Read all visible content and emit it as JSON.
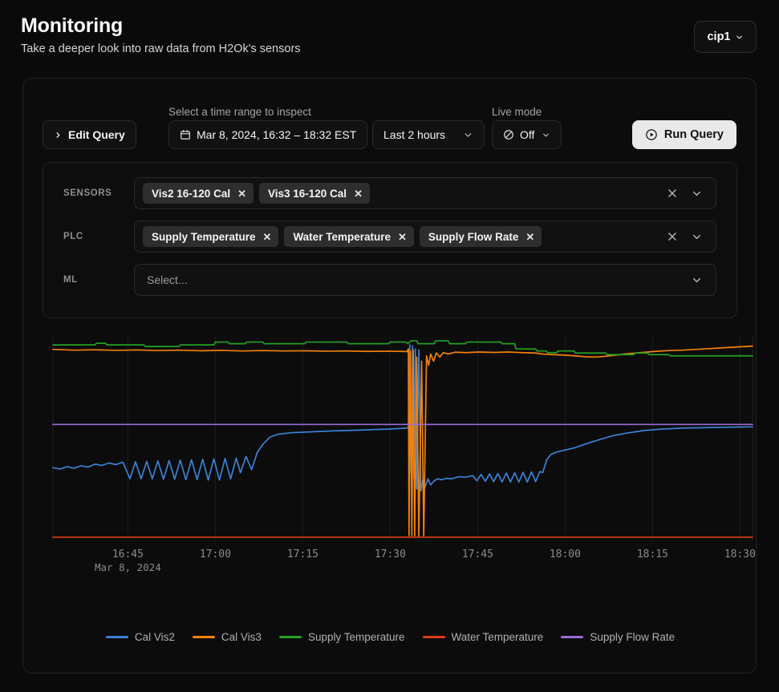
{
  "header": {
    "title": "Monitoring",
    "subtitle": "Take a deeper look into raw data from H2Ok's sensors",
    "site_select": {
      "value": "cip1",
      "icon": "chevron-down-icon"
    }
  },
  "toolbar": {
    "edit_query": {
      "label": "Edit Query",
      "icon": "chevron-right-icon"
    },
    "time_range_label": "Select a time range to inspect",
    "time_range_value": "Mar 8, 2024, 16:32 – 18:32 EST",
    "time_range_icon": "calendar-icon",
    "range_preset_value": "Last 2 hours",
    "range_preset_icon": "chevron-down-icon",
    "live_mode_label": "Live mode",
    "live_mode_value": "Off",
    "live_mode_icon": "circle-slash-icon",
    "run_query": {
      "label": "Run Query",
      "icon": "play-circle-icon"
    }
  },
  "selectors": [
    {
      "label": "SENSORS",
      "tags": [
        "Vis2 16-120 Cal",
        "Vis3 16-120 Cal"
      ],
      "placeholder": "",
      "clear_icon": "close-icon",
      "expand_icon": "chevron-down-icon",
      "has_actions": true
    },
    {
      "label": "PLC",
      "tags": [
        "Supply Temperature",
        "Water Temperature",
        "Supply Flow Rate"
      ],
      "placeholder": "",
      "clear_icon": "close-icon",
      "expand_icon": "chevron-down-icon",
      "has_actions": true
    },
    {
      "label": "ML",
      "tags": [],
      "placeholder": "Select...",
      "clear_icon": "",
      "expand_icon": "chevron-down-icon",
      "has_actions": false
    }
  ],
  "chart_data": {
    "type": "line",
    "title": "",
    "xlabel": "",
    "ylabel": "",
    "grid": true,
    "legend_position": "bottom",
    "x_date_label": "Mar 8, 2024",
    "x_ticks": [
      "16:45",
      "17:00",
      "17:15",
      "17:30",
      "17:45",
      "18:00",
      "18:15",
      "18:30"
    ],
    "x_tick_positions": [
      0.1071,
      0.2321,
      0.3571,
      0.4821,
      0.6071,
      0.7321,
      0.8571,
      0.9821
    ],
    "x_range": [
      "16:32",
      "18:32"
    ],
    "ylim": [
      0,
      1
    ],
    "series": [
      {
        "name": "Cal Vis2",
        "color": "#3b82d4",
        "points": [
          [
            0.0,
            0.355
          ],
          [
            0.01,
            0.348
          ],
          [
            0.02,
            0.36
          ],
          [
            0.03,
            0.352
          ],
          [
            0.04,
            0.364
          ],
          [
            0.05,
            0.358
          ],
          [
            0.06,
            0.372
          ],
          [
            0.07,
            0.366
          ],
          [
            0.08,
            0.378
          ],
          [
            0.09,
            0.37
          ],
          [
            0.1,
            0.382
          ],
          [
            0.11,
            0.3
          ],
          [
            0.118,
            0.384
          ],
          [
            0.126,
            0.3
          ],
          [
            0.134,
            0.386
          ],
          [
            0.142,
            0.3
          ],
          [
            0.15,
            0.388
          ],
          [
            0.158,
            0.298
          ],
          [
            0.166,
            0.39
          ],
          [
            0.174,
            0.298
          ],
          [
            0.182,
            0.392
          ],
          [
            0.19,
            0.296
          ],
          [
            0.198,
            0.394
          ],
          [
            0.206,
            0.296
          ],
          [
            0.214,
            0.396
          ],
          [
            0.222,
            0.294
          ],
          [
            0.23,
            0.398
          ],
          [
            0.238,
            0.294
          ],
          [
            0.246,
            0.4
          ],
          [
            0.254,
            0.3
          ],
          [
            0.262,
            0.402
          ],
          [
            0.268,
            0.33
          ],
          [
            0.276,
            0.41
          ],
          [
            0.284,
            0.345
          ],
          [
            0.292,
            0.43
          ],
          [
            0.3,
            0.47
          ],
          [
            0.31,
            0.505
          ],
          [
            0.322,
            0.52
          ],
          [
            0.34,
            0.527
          ],
          [
            0.36,
            0.53
          ],
          [
            0.38,
            0.533
          ],
          [
            0.4,
            0.536
          ],
          [
            0.42,
            0.538
          ],
          [
            0.44,
            0.54
          ],
          [
            0.46,
            0.543
          ],
          [
            0.48,
            0.545
          ],
          [
            0.495,
            0.548
          ],
          [
            0.505,
            0.55
          ],
          [
            0.508,
            0.552
          ],
          [
            0.51,
            0.96
          ],
          [
            0.512,
            0.33
          ],
          [
            0.514,
            0.955
          ],
          [
            0.516,
            0.3
          ],
          [
            0.518,
            0.94
          ],
          [
            0.52,
            0.25
          ],
          [
            0.523,
            0.935
          ],
          [
            0.526,
            0.24
          ],
          [
            0.529,
            0.3
          ],
          [
            0.532,
            0.26
          ],
          [
            0.536,
            0.3
          ],
          [
            0.54,
            0.27
          ],
          [
            0.545,
            0.29
          ],
          [
            0.55,
            0.3
          ],
          [
            0.556,
            0.295
          ],
          [
            0.562,
            0.302
          ],
          [
            0.57,
            0.3
          ],
          [
            0.58,
            0.31
          ],
          [
            0.59,
            0.308
          ],
          [
            0.6,
            0.316
          ],
          [
            0.606,
            0.29
          ],
          [
            0.612,
            0.322
          ],
          [
            0.618,
            0.288
          ],
          [
            0.624,
            0.324
          ],
          [
            0.63,
            0.286
          ],
          [
            0.636,
            0.326
          ],
          [
            0.642,
            0.284
          ],
          [
            0.648,
            0.328
          ],
          [
            0.654,
            0.284
          ],
          [
            0.66,
            0.33
          ],
          [
            0.666,
            0.284
          ],
          [
            0.672,
            0.332
          ],
          [
            0.678,
            0.284
          ],
          [
            0.684,
            0.334
          ],
          [
            0.69,
            0.286
          ],
          [
            0.696,
            0.336
          ],
          [
            0.7,
            0.33
          ],
          [
            0.706,
            0.395
          ],
          [
            0.712,
            0.42
          ],
          [
            0.72,
            0.432
          ],
          [
            0.73,
            0.44
          ],
          [
            0.745,
            0.452
          ],
          [
            0.76,
            0.47
          ],
          [
            0.78,
            0.492
          ],
          [
            0.8,
            0.512
          ],
          [
            0.82,
            0.525
          ],
          [
            0.845,
            0.538
          ],
          [
            0.87,
            0.545
          ],
          [
            0.9,
            0.55
          ],
          [
            0.93,
            0.552
          ],
          [
            0.96,
            0.554
          ],
          [
            1.0,
            0.556
          ]
        ]
      },
      {
        "name": "Cal Vis3",
        "color": "#f2810c",
        "points": [
          [
            0.0,
            0.938
          ],
          [
            0.03,
            0.934
          ],
          [
            0.06,
            0.936
          ],
          [
            0.09,
            0.933
          ],
          [
            0.12,
            0.935
          ],
          [
            0.15,
            0.932
          ],
          [
            0.18,
            0.934
          ],
          [
            0.21,
            0.931
          ],
          [
            0.24,
            0.933
          ],
          [
            0.27,
            0.93
          ],
          [
            0.3,
            0.932
          ],
          [
            0.33,
            0.93
          ],
          [
            0.36,
            0.931
          ],
          [
            0.39,
            0.929
          ],
          [
            0.42,
            0.93
          ],
          [
            0.45,
            0.928
          ],
          [
            0.48,
            0.929
          ],
          [
            0.5,
            0.928
          ],
          [
            0.506,
            0.927
          ],
          [
            0.508,
            0.94
          ],
          [
            0.509,
            0.02
          ],
          [
            0.511,
            0.93
          ],
          [
            0.513,
            0.02
          ],
          [
            0.515,
            0.935
          ],
          [
            0.517,
            0.018
          ],
          [
            0.52,
            0.9
          ],
          [
            0.523,
            0.018
          ],
          [
            0.527,
            0.88
          ],
          [
            0.53,
            0.018
          ],
          [
            0.534,
            0.905
          ],
          [
            0.537,
            0.86
          ],
          [
            0.54,
            0.915
          ],
          [
            0.544,
            0.88
          ],
          [
            0.548,
            0.92
          ],
          [
            0.553,
            0.9
          ],
          [
            0.558,
            0.922
          ],
          [
            0.565,
            0.915
          ],
          [
            0.575,
            0.924
          ],
          [
            0.59,
            0.922
          ],
          [
            0.61,
            0.925
          ],
          [
            0.63,
            0.923
          ],
          [
            0.65,
            0.925
          ],
          [
            0.67,
            0.922
          ],
          [
            0.69,
            0.92
          ],
          [
            0.7,
            0.915
          ],
          [
            0.715,
            0.912
          ],
          [
            0.73,
            0.91
          ],
          [
            0.745,
            0.906
          ],
          [
            0.76,
            0.902
          ],
          [
            0.775,
            0.9
          ],
          [
            0.79,
            0.904
          ],
          [
            0.805,
            0.91
          ],
          [
            0.82,
            0.916
          ],
          [
            0.84,
            0.922
          ],
          [
            0.86,
            0.928
          ],
          [
            0.88,
            0.932
          ],
          [
            0.9,
            0.934
          ],
          [
            0.92,
            0.938
          ],
          [
            0.94,
            0.942
          ],
          [
            0.96,
            0.946
          ],
          [
            0.98,
            0.95
          ],
          [
            1.0,
            0.954
          ]
        ]
      },
      {
        "name": "Supply Temperature",
        "color": "#23a122",
        "points": [
          [
            0.0,
            0.96
          ],
          [
            0.06,
            0.96
          ],
          [
            0.062,
            0.968
          ],
          [
            0.075,
            0.968
          ],
          [
            0.077,
            0.96
          ],
          [
            0.13,
            0.96
          ],
          [
            0.132,
            0.952
          ],
          [
            0.18,
            0.952
          ],
          [
            0.182,
            0.96
          ],
          [
            0.23,
            0.96
          ],
          [
            0.232,
            0.974
          ],
          [
            0.25,
            0.974
          ],
          [
            0.252,
            0.966
          ],
          [
            0.275,
            0.966
          ],
          [
            0.277,
            0.974
          ],
          [
            0.3,
            0.974
          ],
          [
            0.302,
            0.966
          ],
          [
            0.36,
            0.966
          ],
          [
            0.362,
            0.974
          ],
          [
            0.42,
            0.974
          ],
          [
            0.422,
            0.966
          ],
          [
            0.48,
            0.966
          ],
          [
            0.482,
            0.974
          ],
          [
            0.505,
            0.974
          ],
          [
            0.507,
            0.966
          ],
          [
            0.512,
            0.98
          ],
          [
            0.52,
            0.98
          ],
          [
            0.522,
            0.966
          ],
          [
            0.545,
            0.966
          ],
          [
            0.547,
            0.98
          ],
          [
            0.565,
            0.98
          ],
          [
            0.567,
            0.966
          ],
          [
            0.59,
            0.966
          ],
          [
            0.592,
            0.974
          ],
          [
            0.64,
            0.974
          ],
          [
            0.642,
            0.966
          ],
          [
            0.66,
            0.966
          ],
          [
            0.662,
            0.94
          ],
          [
            0.69,
            0.94
          ],
          [
            0.692,
            0.93
          ],
          [
            0.705,
            0.93
          ],
          [
            0.707,
            0.922
          ],
          [
            0.72,
            0.922
          ],
          [
            0.722,
            0.93
          ],
          [
            0.745,
            0.93
          ],
          [
            0.747,
            0.92
          ],
          [
            0.79,
            0.92
          ],
          [
            0.792,
            0.912
          ],
          [
            0.83,
            0.912
          ],
          [
            0.832,
            0.92
          ],
          [
            0.85,
            0.92
          ],
          [
            0.852,
            0.912
          ],
          [
            0.88,
            0.912
          ],
          [
            0.882,
            0.906
          ],
          [
            0.94,
            0.906
          ],
          [
            0.942,
            0.906
          ],
          [
            1.0,
            0.906
          ]
        ]
      },
      {
        "name": "Water Temperature",
        "color": "#e03c12",
        "points": [
          [
            0.0,
            0.012
          ],
          [
            0.2,
            0.012
          ],
          [
            0.4,
            0.012
          ],
          [
            0.5,
            0.012
          ],
          [
            0.51,
            0.012
          ],
          [
            0.6,
            0.012
          ],
          [
            0.8,
            0.012
          ],
          [
            1.0,
            0.012
          ]
        ]
      },
      {
        "name": "Supply Flow Rate",
        "color": "#9b6ad4",
        "points": [
          [
            0.0,
            0.568
          ],
          [
            0.15,
            0.568
          ],
          [
            0.3,
            0.568
          ],
          [
            0.45,
            0.568
          ],
          [
            0.505,
            0.568
          ],
          [
            0.52,
            0.568
          ],
          [
            0.65,
            0.568
          ],
          [
            0.8,
            0.568
          ],
          [
            1.0,
            0.568
          ]
        ]
      }
    ]
  }
}
